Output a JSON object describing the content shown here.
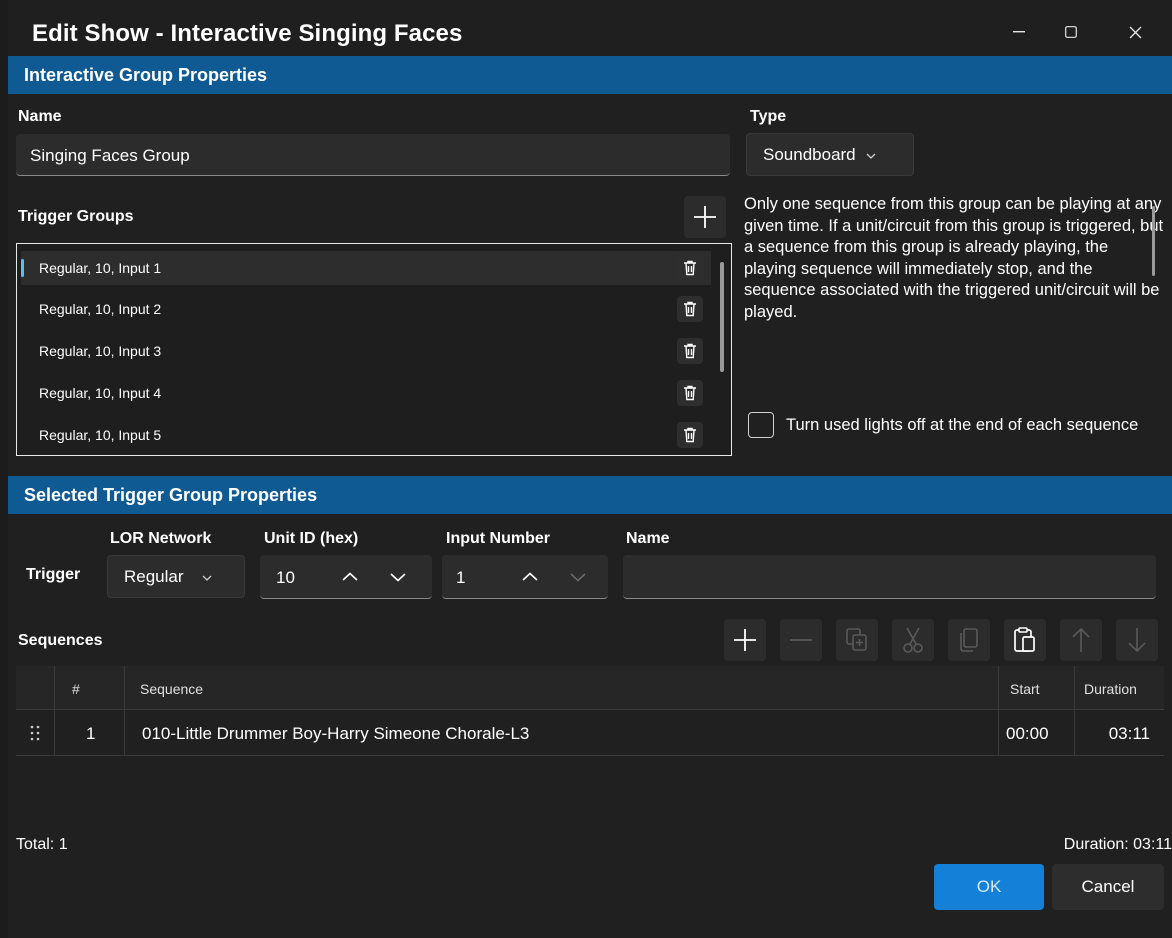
{
  "window": {
    "title": "Edit Show - Interactive Singing Faces"
  },
  "section1": {
    "title": "Interactive Group Properties"
  },
  "name": {
    "label": "Name",
    "value": "Singing Faces Group"
  },
  "type": {
    "label": "Type",
    "value": "Soundboard"
  },
  "trigger_groups": {
    "label": "Trigger Groups",
    "items": [
      "Regular, 10, Input 1",
      "Regular, 10, Input 2",
      "Regular, 10, Input 3",
      "Regular, 10, Input 4",
      "Regular, 10, Input 5"
    ]
  },
  "description": "Only one sequence from this group can be playing at any given time. If a unit/circuit from this group is triggered, but a sequence from this group is already playing, the playing sequence will immediately stop, and the sequence associated with the triggered unit/circuit will be played.",
  "checkbox": {
    "label": "Turn used lights off at the end of each sequence",
    "checked": false
  },
  "section2": {
    "title": "Selected Trigger Group Properties"
  },
  "trigger": {
    "label": "Trigger",
    "network_label": "LOR Network",
    "network_value": "Regular",
    "unit_label": "Unit ID (hex)",
    "unit_value": "10",
    "input_label": "Input Number",
    "input_value": "1",
    "name_label": "Name",
    "name_value": ""
  },
  "sequences": {
    "label": "Sequences",
    "columns": [
      "#",
      "Sequence",
      "Start",
      "Duration"
    ],
    "rows": [
      {
        "num": "1",
        "sequence": "010-Little Drummer Boy-Harry Simeone Chorale-L3",
        "start": "00:00",
        "duration": "03:11"
      }
    ]
  },
  "footer": {
    "total": "Total: 1",
    "duration": "Duration: 03:11"
  },
  "buttons": {
    "ok": "OK",
    "cancel": "Cancel"
  },
  "colors": {
    "accent": "#0f5a93",
    "ok_button": "#1580d8",
    "selection_bar": "#4cc2ff"
  }
}
